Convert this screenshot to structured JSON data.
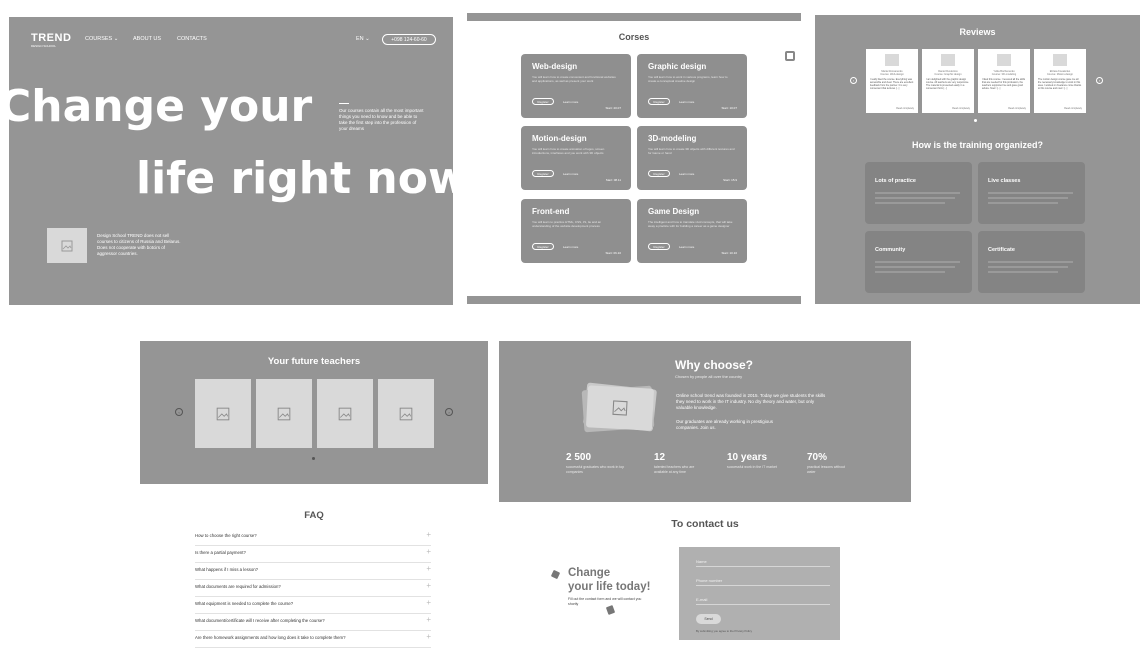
{
  "hero": {
    "logo": "TREND",
    "logo_sub": "DESIGN SCHOOL",
    "nav": [
      "COURSES ⌄",
      "ABOUT US",
      "CONTACTS"
    ],
    "lang": "EN ⌄",
    "phone": "+098 124-60-60",
    "headline_1": "Change your",
    "headline_2": "life right now",
    "description": "Our courses contain all the most important things you need to know and be able to take the first step into the profession of your dreams",
    "banner_text": "Design School TREND does not sell courses to citizens of Russia and Belarus. Does not cooperate with botcirs of aggressor countries."
  },
  "courses": {
    "title": "Corses",
    "register_label": "Register",
    "learn_more_label": "Learn more",
    "items": [
      {
        "name": "Web-design",
        "desc": "You will learn how to create convenient and functional websites and applications, as well as present your work",
        "start": "Start: 20.07"
      },
      {
        "name": "Graphic design",
        "desc": "You will learn how to work in various programs, learn how to create a conceptual creative design",
        "start": "Start: 10.07"
      },
      {
        "name": "Motion-design",
        "desc": "You will learn how to create animation of logos, screen introductions, interfaces and you work with 3D objects",
        "start": "Start: 08.11"
      },
      {
        "name": "3D-modeling",
        "desc": "You will learn how to create 3D objects with different textures and for Game or hand",
        "start": "Start: 15.9"
      },
      {
        "name": "Front-end",
        "desc": "You will learn to practice HTML, CSS, JS, ite and an understanding of the website development process",
        "start": "Start: 06.10"
      },
      {
        "name": "Game Design",
        "desc": "The intelligent and how to translate vivid concepts, that will take away a practice with for building a career as a game designer",
        "start": "Start: 10.10"
      }
    ]
  },
  "reviews": {
    "title": "Reviews",
    "read_completely": "Read completely",
    "items": [
      {
        "name": "Maria Romanenko",
        "course": "Course: Web-design",
        "text": "I really liked the course. Everything was accessible and clear. There are excellent feedback from the partner. It is very convenient that lectures [...]"
      },
      {
        "name": "Daniel Dvelentov",
        "course": "Course: Graphic design",
        "text": "I am delighted with the graphic design course. All teachers are very responsive. The material is presented easily in a convenient form [...]"
      },
      {
        "name": "Yuliia Bozhenenko",
        "course": "Course: 3D-modeling",
        "text": "I liked this course. I received all the skills that are needed for this profession, the teachers supported me and gave good advice. Now I [...]"
      },
      {
        "name": "Elizaia Kovalenko",
        "course": "Course: Motion-design",
        "text": "The motion design course gave me all the necessary knowledge to work in this area. I worked on freelance come thanks to this course and now I [...]"
      }
    ],
    "training_title": "How is the training organized?",
    "training": [
      "Lots of practice",
      "Live classes",
      "Community",
      "Certificate"
    ]
  },
  "teachers": {
    "title": "Your future teachers"
  },
  "faq": {
    "title": "FAQ",
    "items": [
      "How to choose the right course?",
      "Is there a partial payment?",
      "What happens if I miss a lesson?",
      "What documents are required for admission?",
      "What equipment is needed to complete the course?",
      "What document/certificate will I receive after completing the course?",
      "Are there homework assignments and how long does it take to complete them?"
    ]
  },
  "why": {
    "title": "Why choose?",
    "subtitle": "Chosen by people all over the country",
    "para1": "Online school trend was founded in 2015. Today we give students the skills they need to work in the IT industry. No dry theory and water, but only valuable knowledge.",
    "para2": "Our graduates are already working in prestigious companies. Join us.",
    "stats": [
      {
        "value": "2 500",
        "label": "successful graduates who work in top companies"
      },
      {
        "value": "12",
        "label": "talented teachers who are available at any time"
      },
      {
        "value": "10 years",
        "label": "successful work in the IT market"
      },
      {
        "value": "70%",
        "label": "practical lessons without water"
      }
    ]
  },
  "contact": {
    "title": "To contact us",
    "heading": "Change\nyour life today!",
    "desc": "Fill out the contact form and we will contact you shortly",
    "fields": [
      "Name",
      "Phone number",
      "E-mail"
    ],
    "send": "Send",
    "agree": "By submitting you agree to the Privacy Policy"
  }
}
